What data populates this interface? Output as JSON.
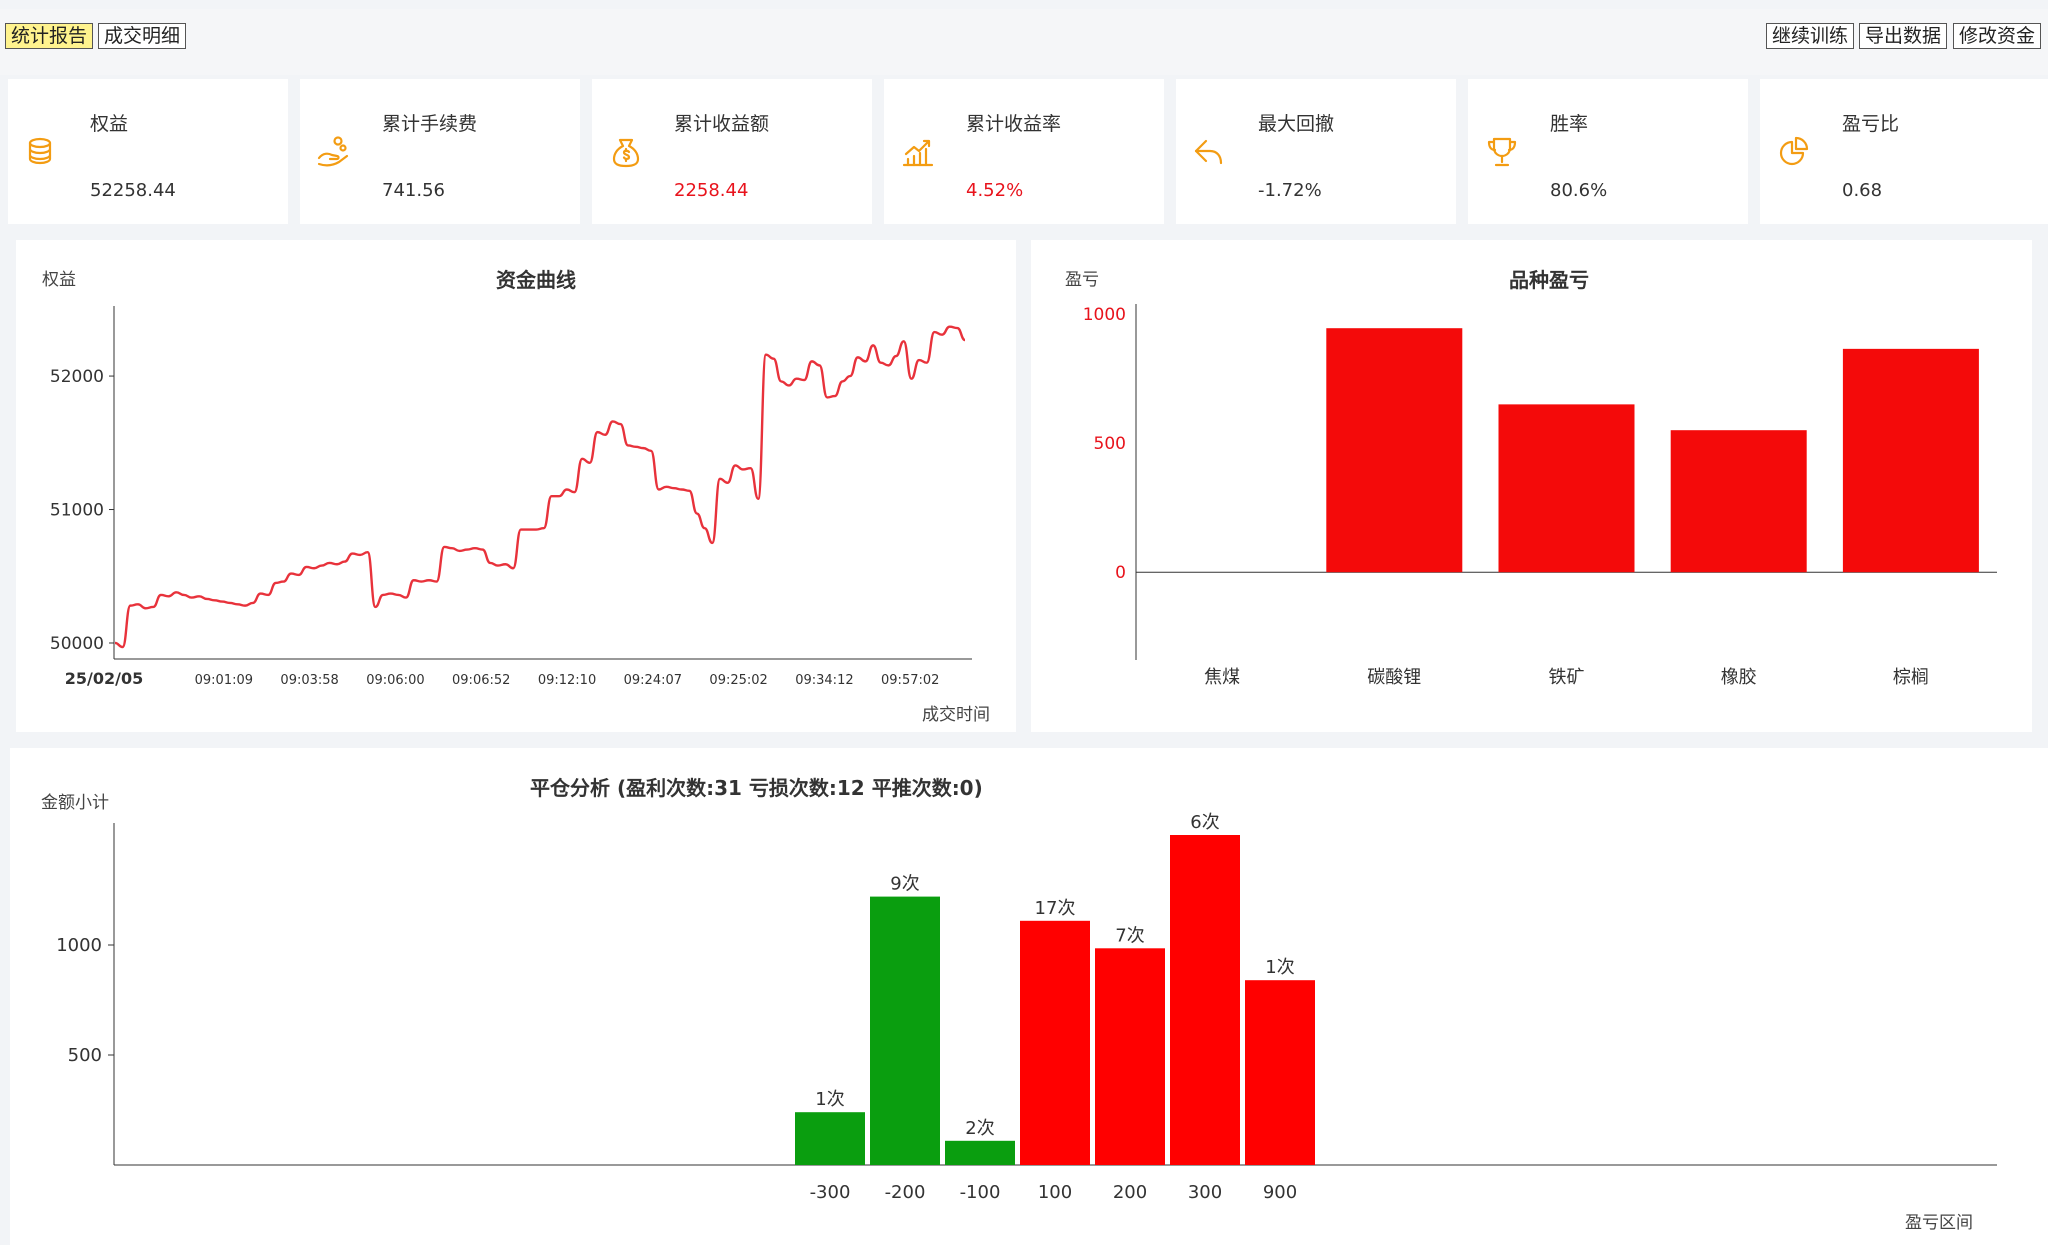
{
  "tabs": [
    {
      "label": "统计报告",
      "active": true
    },
    {
      "label": "成交明细",
      "active": false
    }
  ],
  "actions": [
    {
      "label": "继续训练"
    },
    {
      "label": "导出数据"
    },
    {
      "label": "修改资金"
    }
  ],
  "stats": [
    {
      "label": "权益",
      "value": "52258.44",
      "icon": "coins-icon",
      "value_color": "#333333"
    },
    {
      "label": "累计手续费",
      "value": "741.56",
      "icon": "hand-coins-icon",
      "value_color": "#333333"
    },
    {
      "label": "累计收益额",
      "value": "2258.44",
      "icon": "money-bag-icon",
      "value_color": "#e8131c"
    },
    {
      "label": "累计收益率",
      "value": "4.52%",
      "icon": "growth-chart-icon",
      "value_color": "#e8131c"
    },
    {
      "label": "最大回撤",
      "value": "-1.72%",
      "icon": "undo-arrow-icon",
      "value_color": "#333333"
    },
    {
      "label": "胜率",
      "value": "80.6%",
      "icon": "trophy-icon",
      "value_color": "#333333"
    },
    {
      "label": "盈亏比",
      "value": "0.68",
      "icon": "pie-icon",
      "value_color": "#333333"
    }
  ],
  "colors": {
    "accent_orange": "#f39c12",
    "profit_red": "#f40a0a",
    "loss_green": "#0a9e0f",
    "line_red": "#e8323b"
  },
  "chart_data": [
    {
      "type": "line",
      "title": "资金曲线",
      "ylabel": "权益",
      "xlabel": "成交时间",
      "ylim": [
        49880,
        52480
      ],
      "yticks": [
        50000,
        51000,
        52000
      ],
      "x_tick_labels": [
        "25/02/05",
        "09:01:09",
        "09:03:58",
        "09:06:00",
        "09:06:52",
        "09:12:10",
        "09:24:07",
        "09:25:02",
        "09:34:12",
        "09:57:02"
      ],
      "series": [
        {
          "values": [
            50000,
            49970,
            50280,
            50290,
            50260,
            50270,
            50360,
            50350,
            50380,
            50360,
            50340,
            50350,
            50330,
            50320,
            50310,
            50300,
            50290,
            50280,
            50300,
            50370,
            50360,
            50450,
            50460,
            50520,
            50510,
            50570,
            50560,
            50580,
            50600,
            50590,
            50610,
            50670,
            50660,
            50680,
            50270,
            50360,
            50370,
            50360,
            50340,
            50470,
            50460,
            50470,
            50460,
            50720,
            50710,
            50690,
            50700,
            50710,
            50700,
            50600,
            50580,
            50590,
            50560,
            50850,
            50850,
            50850,
            50860,
            51100,
            51100,
            51150,
            51130,
            51380,
            51350,
            51580,
            51560,
            51660,
            51640,
            51480,
            51470,
            51460,
            51440,
            51150,
            51170,
            51160,
            51150,
            51140,
            50970,
            50860,
            50750,
            51230,
            51200,
            51330,
            51300,
            51310,
            51080,
            52160,
            52130,
            51960,
            51930,
            51980,
            51970,
            52110,
            52080,
            51840,
            51850,
            51960,
            52000,
            52140,
            52110,
            52230,
            52100,
            52080,
            52150,
            52260,
            51980,
            52120,
            52100,
            52330,
            52310,
            52370,
            52360,
            52270
          ]
        }
      ]
    },
    {
      "type": "bar",
      "title": "品种盈亏",
      "ylabel": "盈亏",
      "categories": [
        "焦煤",
        "碳酸锂",
        "铁矿",
        "橡胶",
        "棕榈"
      ],
      "values": [
        0,
        945,
        650,
        550,
        865
      ],
      "ylim": [
        -340,
        1000
      ],
      "yticks": [
        0,
        500,
        1000
      ]
    },
    {
      "type": "bar",
      "title": "平仓分析 (盈利次数:31 亏损次数:12 平推次数:0)",
      "ylabel": "金额小计",
      "xlabel": "盈亏区间",
      "categories": [
        "-300",
        "-200",
        "-100",
        "100",
        "200",
        "300",
        "900"
      ],
      "values": [
        240,
        1220,
        110,
        1110,
        985,
        1500,
        840
      ],
      "labels": [
        "1次",
        "9次",
        "2次",
        "17次",
        "7次",
        "6次",
        "1次"
      ],
      "colors": [
        "#0a9e0f",
        "#0a9e0f",
        "#0a9e0f",
        "#ff0000",
        "#ff0000",
        "#ff0000",
        "#ff0000"
      ],
      "ylim": [
        0,
        1560
      ],
      "yticks": [
        500,
        1000
      ]
    }
  ]
}
